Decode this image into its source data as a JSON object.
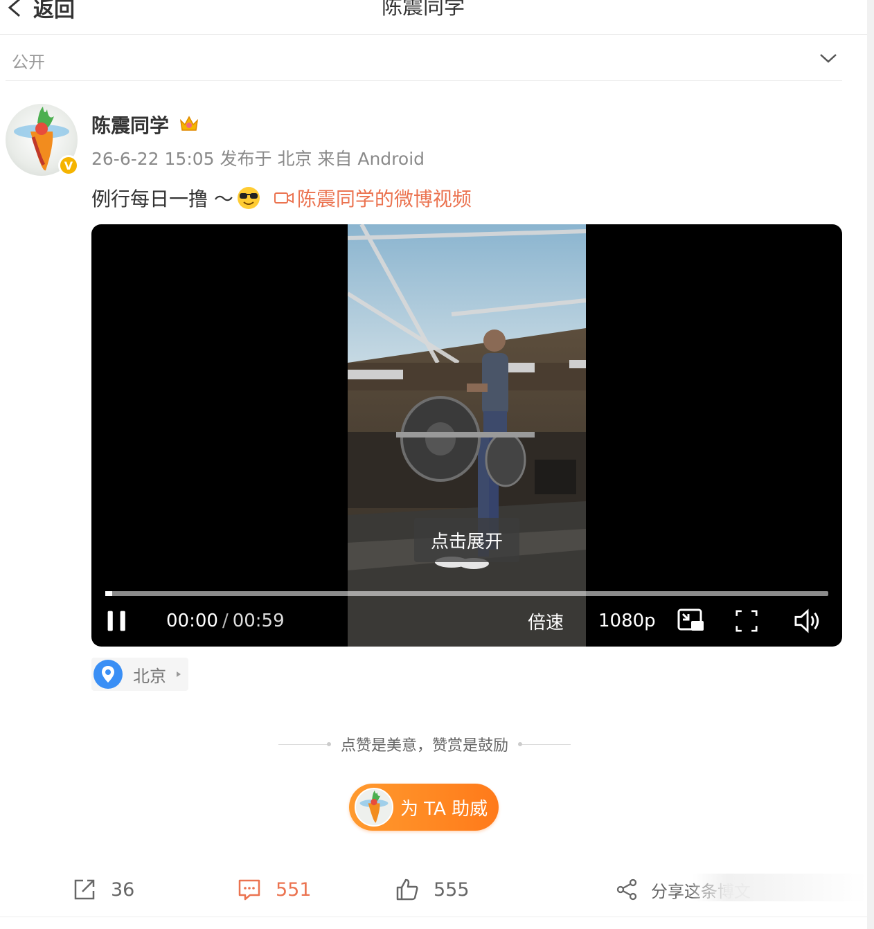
{
  "header": {
    "back_label": "返回",
    "title": "陈震同学"
  },
  "visibility": {
    "label": "公开"
  },
  "author": {
    "name": "陈震同学",
    "meta": "26-6-22 15:05  发布于 北京  来自 Android"
  },
  "post": {
    "text": "例行每日一撸 ～",
    "video_link": "陈震同学的微博视频"
  },
  "video": {
    "expand_label": "点击展开",
    "current_time": "00:00",
    "separator": "/",
    "duration": "00:59",
    "speed_label": "倍速",
    "quality_label": "1080p",
    "progress": 0.01
  },
  "location": {
    "label": "北京"
  },
  "reward": {
    "note": "点赞是美意，赞赏是鼓励",
    "button_label": "为 TA 助威"
  },
  "actions": {
    "repost_count": "36",
    "comment_count": "551",
    "like_count": "555",
    "share_label": "分享这条博文"
  },
  "colors": {
    "accent": "#eb7350",
    "reward_orange": "#ff8a24",
    "verified": "#f5b400",
    "location_blue": "#3a8ff5"
  }
}
